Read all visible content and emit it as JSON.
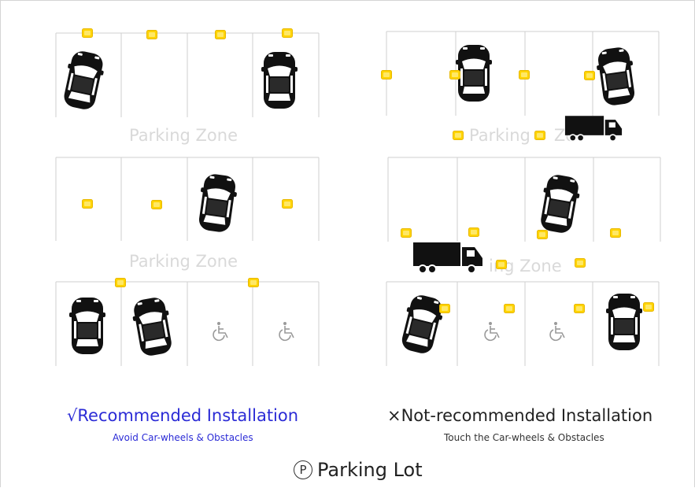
{
  "zones": {
    "zone_label": "Parking Zone",
    "truncated_label_a": "Parking",
    "truncated_label_b": "Zo",
    "truncated_label_c": "ing Zone"
  },
  "captions": {
    "recommended_title": "√Recommended Installation",
    "recommended_subtitle": "Avoid Car-wheels & Obstacles",
    "not_recommended_title": "×Not-recommended Installation",
    "not_recommended_subtitle": "Touch the Car-wheels & Obstacles"
  },
  "footer": {
    "icon_letter": "P",
    "title": "Parking Lot"
  },
  "colors": {
    "sensor": "#ffd400",
    "line": "#cfcfcf",
    "zone_text": "#d9d9d9",
    "recommended_text": "#2b2bd6",
    "vehicle": "#111111"
  },
  "icons": {
    "sensor": "sensor-icon",
    "car": "car-icon",
    "truck": "truck-icon",
    "accessible": "wheelchair-icon"
  }
}
